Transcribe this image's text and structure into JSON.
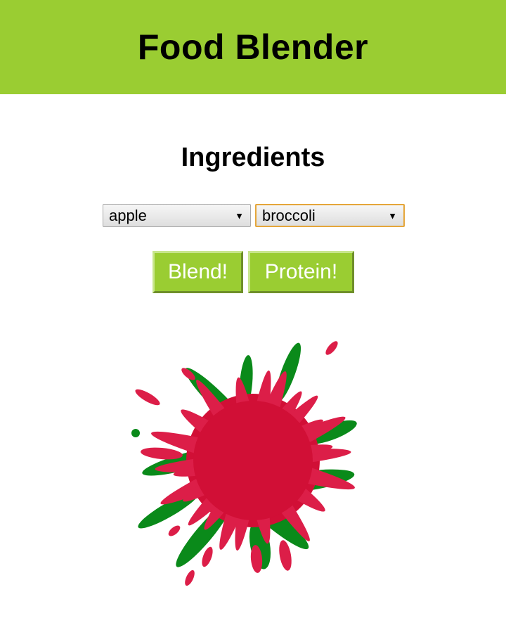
{
  "header": {
    "title": "Food Blender"
  },
  "main": {
    "section_title": "Ingredients",
    "selects": [
      {
        "value": "apple",
        "arrow": "▼"
      },
      {
        "value": "broccoli",
        "arrow": "▼"
      }
    ],
    "buttons": {
      "blend_label": "Blend!",
      "protein_label": "Protein!"
    }
  },
  "colors": {
    "brand": "#9acd32",
    "splat_red": "#d10f36",
    "splat_pink": "#dc1e48",
    "splat_green": "#0a8a1a",
    "select_focus": "#e5a63a"
  },
  "result": {
    "image": "smoothie-splat",
    "ingredient_colors": [
      "red",
      "green"
    ]
  }
}
